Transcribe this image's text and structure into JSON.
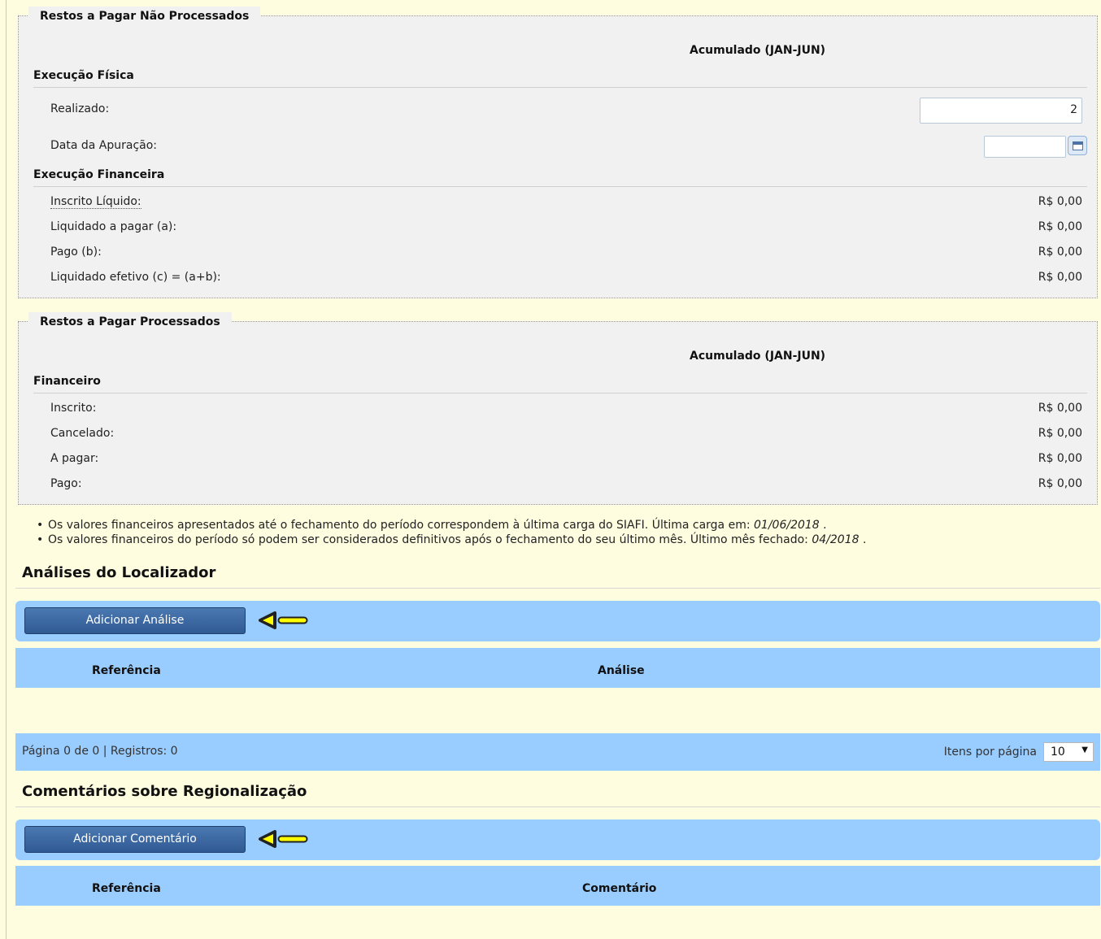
{
  "rp_nao_processados": {
    "legend": "Restos a Pagar Não Processados",
    "col_header": "Acumulado (JAN-JUN)",
    "fisica": {
      "title": "Execução Física",
      "realizado_label": "Realizado:",
      "realizado_value": "2",
      "data_label": "Data da Apuração:",
      "data_value": ""
    },
    "financeira": {
      "title": "Execução Financeira",
      "rows": [
        {
          "label": "Inscrito Líquido:",
          "value": "R$ 0,00"
        },
        {
          "label": "Liquidado a pagar (a):",
          "value": "R$ 0,00"
        },
        {
          "label": "Pago (b):",
          "value": "R$ 0,00"
        },
        {
          "label": "Liquidado efetivo (c) = (a+b):",
          "value": "R$ 0,00"
        }
      ]
    }
  },
  "rp_processados": {
    "legend": "Restos a Pagar Processados",
    "col_header": "Acumulado (JAN-JUN)",
    "financeiro": {
      "title": "Financeiro",
      "rows": [
        {
          "label": "Inscrito:",
          "value": "R$ 0,00"
        },
        {
          "label": "Cancelado:",
          "value": "R$ 0,00"
        },
        {
          "label": "A pagar:",
          "value": "R$ 0,00"
        },
        {
          "label": "Pago:",
          "value": "R$ 0,00"
        }
      ]
    }
  },
  "notes": [
    {
      "text": "Os valores financeiros apresentados até o fechamento do período correspondem à última carga do SIAFI. Última carga em: ",
      "em": "01/06/2018",
      "end": " ."
    },
    {
      "text": "Os valores financeiros do período só podem ser considerados definitivos após o fechamento do seu último mês. Último mês fechado: ",
      "em": "04/2018",
      "end": " ."
    }
  ],
  "analises": {
    "title": "Análises do Localizador",
    "add_button": "Adicionar Análise",
    "columns": [
      "Referência",
      "Análise"
    ],
    "pager_info": "Página 0 de 0 | Registros: 0",
    "per_page_label": "Itens por página",
    "per_page_value": "10"
  },
  "comentarios": {
    "title": "Comentários sobre Regionalização",
    "add_button": "Adicionar Comentário",
    "columns": [
      "Referência",
      "Comentário"
    ]
  },
  "icons": {
    "calendar": "calendar-icon",
    "arrow": "arrow-left-icon",
    "arrow_color": "#ffff00",
    "caret": "caret-down-icon"
  },
  "colors": {
    "page_bg": "#fffde0",
    "panel_bg": "#f1f1f1",
    "bar_bg": "#99ccff",
    "button_bg": "#3a659e"
  }
}
